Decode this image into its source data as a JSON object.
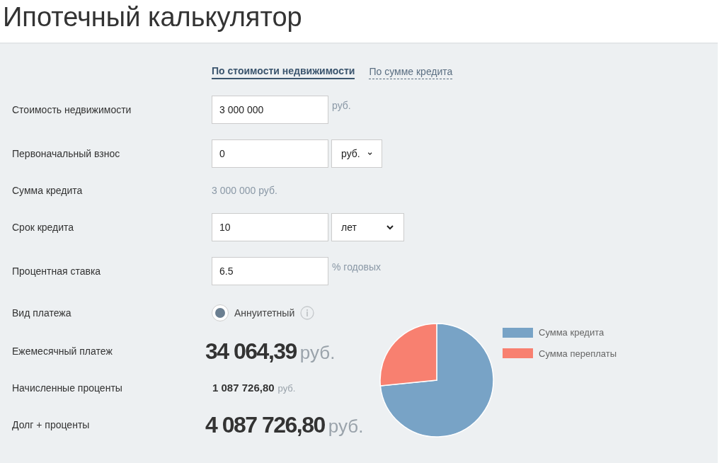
{
  "title": "Ипотечный калькулятор",
  "tabs": [
    {
      "label": "По стоимости недвижимости",
      "selected": true
    },
    {
      "label": "По сумме кредита",
      "selected": false
    }
  ],
  "fields": [
    {
      "kind": "input",
      "label": "Стоимость недвижимости",
      "value": "3 000 000",
      "unit": "руб."
    },
    {
      "kind": "input-select",
      "label": "Первоначальный взнос",
      "value": "0",
      "select": "руб."
    },
    {
      "kind": "text",
      "label": "Сумма кредита",
      "value": "3 000 000 руб."
    },
    {
      "kind": "input-select",
      "label": "Срок кредита",
      "value": "10",
      "select": "лет"
    },
    {
      "kind": "input",
      "label": "Процентная ставка",
      "value": "6.5",
      "unit": "% годовых"
    },
    {
      "kind": "radio",
      "label": "Вид платежа",
      "option": "Аннуитетный",
      "selected": true
    }
  ],
  "results": [
    {
      "kind": "big",
      "label": "Ежемесячный платеж",
      "value": "34 064,39",
      "unit": "руб."
    },
    {
      "kind": "small",
      "label": "Начисленные проценты",
      "value": "1 087 726,80",
      "unit": "руб."
    },
    {
      "kind": "big",
      "label": "Долг + проценты",
      "value": "4 087 726,80",
      "unit": "руб."
    }
  ],
  "chart_data": {
    "type": "pie",
    "categories": [
      "Сумма кредита",
      "Сумма переплаты"
    ],
    "values": [
      73.4,
      26.6
    ],
    "colors": [
      "#78a3c6",
      "#f88070"
    ]
  }
}
